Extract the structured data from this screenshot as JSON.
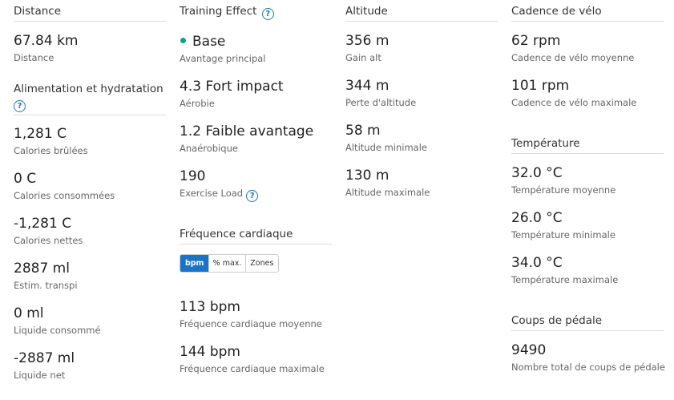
{
  "distance": {
    "header": "Distance",
    "metrics": [
      {
        "value": "67.84 km",
        "label": "Distance"
      }
    ]
  },
  "nutrition": {
    "header": "Alimentation et hydratation",
    "metrics": [
      {
        "value": "1,281 C",
        "label": "Calories brûlées"
      },
      {
        "value": "0 C",
        "label": "Calories consommées"
      },
      {
        "value": "-1,281 C",
        "label": "Calories nettes"
      },
      {
        "value": "2887 ml",
        "label": "Estim. transpi"
      },
      {
        "value": "0 ml",
        "label": "Liquide consommé"
      },
      {
        "value": "-2887 ml",
        "label": "Liquide net"
      }
    ]
  },
  "training_effect": {
    "header": "Training Effect",
    "primary_color": "#10a37f",
    "metrics": [
      {
        "value": "Base",
        "label": "Avantage principal"
      },
      {
        "value": "4.3 Fort impact",
        "label": "Aérobie"
      },
      {
        "value": "1.2 Faible avantage",
        "label": "Anaérobique"
      },
      {
        "value": "190",
        "label": "Exercise Load"
      }
    ]
  },
  "heart_rate": {
    "header": "Fréquence cardiaque",
    "toggle": [
      "bpm",
      "% max.",
      "Zones"
    ],
    "toggle_selected": "bpm",
    "accent_color": "#1a73c9",
    "metrics": [
      {
        "value": "113 bpm",
        "label": "Fréquence cardiaque moyenne"
      },
      {
        "value": "144 bpm",
        "label": "Fréquence cardiaque maximale"
      }
    ]
  },
  "altitude": {
    "header": "Altitude",
    "metrics": [
      {
        "value": "356 m",
        "label": "Gain alt"
      },
      {
        "value": "344 m",
        "label": "Perte d'altitude"
      },
      {
        "value": "58 m",
        "label": "Altitude minimale"
      },
      {
        "value": "130 m",
        "label": "Altitude maximale"
      }
    ]
  },
  "cadence": {
    "header": "Cadence de vélo",
    "metrics": [
      {
        "value": "62 rpm",
        "label": "Cadence de vélo moyenne"
      },
      {
        "value": "101 rpm",
        "label": "Cadence de vélo maximale"
      }
    ]
  },
  "temperature": {
    "header": "Température",
    "metrics": [
      {
        "value": "32.0 °C",
        "label": "Température moyenne"
      },
      {
        "value": "26.0 °C",
        "label": "Température minimale"
      },
      {
        "value": "34.0 °C",
        "label": "Température maximale"
      }
    ]
  },
  "strokes": {
    "header": "Coups de pédale",
    "metrics": [
      {
        "value": "9490",
        "label": "Nombre total de coups de pédale"
      }
    ]
  },
  "help_icon": {
    "glyph": "?",
    "name": "help-icon"
  }
}
